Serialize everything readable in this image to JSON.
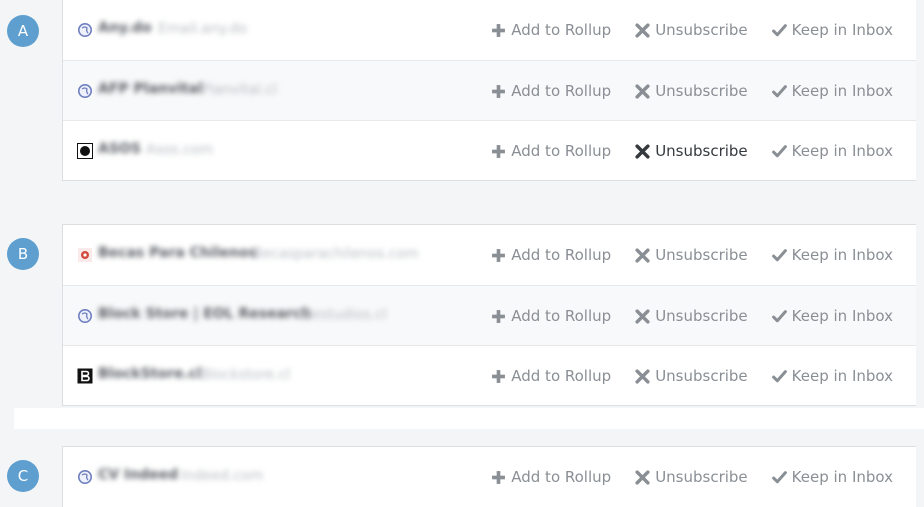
{
  "groups": [
    {
      "letter": "A",
      "rows": [
        {
          "sender": "Any.do",
          "domain": "Email.any.do",
          "icon": "globe-icon"
        },
        {
          "sender": "AFP Planvital",
          "domain": "Planvital.cl",
          "icon": "globe-icon"
        },
        {
          "sender": "ASOS",
          "domain": "Asos.com",
          "icon": "asos-logo-icon"
        }
      ]
    },
    {
      "letter": "B",
      "rows": [
        {
          "sender": "Becas Para Chilenos",
          "domain": "Becasparachilenos.com",
          "icon": "becas-logo-icon"
        },
        {
          "sender": "Block Store | EOL Research",
          "domain": "Eestudios.cl",
          "icon": "globe-icon"
        },
        {
          "sender": "BlockStore.cl",
          "domain": "Blockstore.cl",
          "icon": "blockstore-logo-icon"
        }
      ]
    },
    {
      "letter": "C",
      "rows": [
        {
          "sender": "CV Indeed",
          "domain": "Indeed.com",
          "icon": "globe-icon"
        }
      ]
    }
  ],
  "actions": {
    "rollup": "Add to Rollup",
    "unsubscribe": "Unsubscribe",
    "keep": "Keep in Inbox"
  },
  "colors": {
    "accent": "#5e9fd0",
    "action_text": "#8a8f95",
    "action_active": "#35393e"
  }
}
